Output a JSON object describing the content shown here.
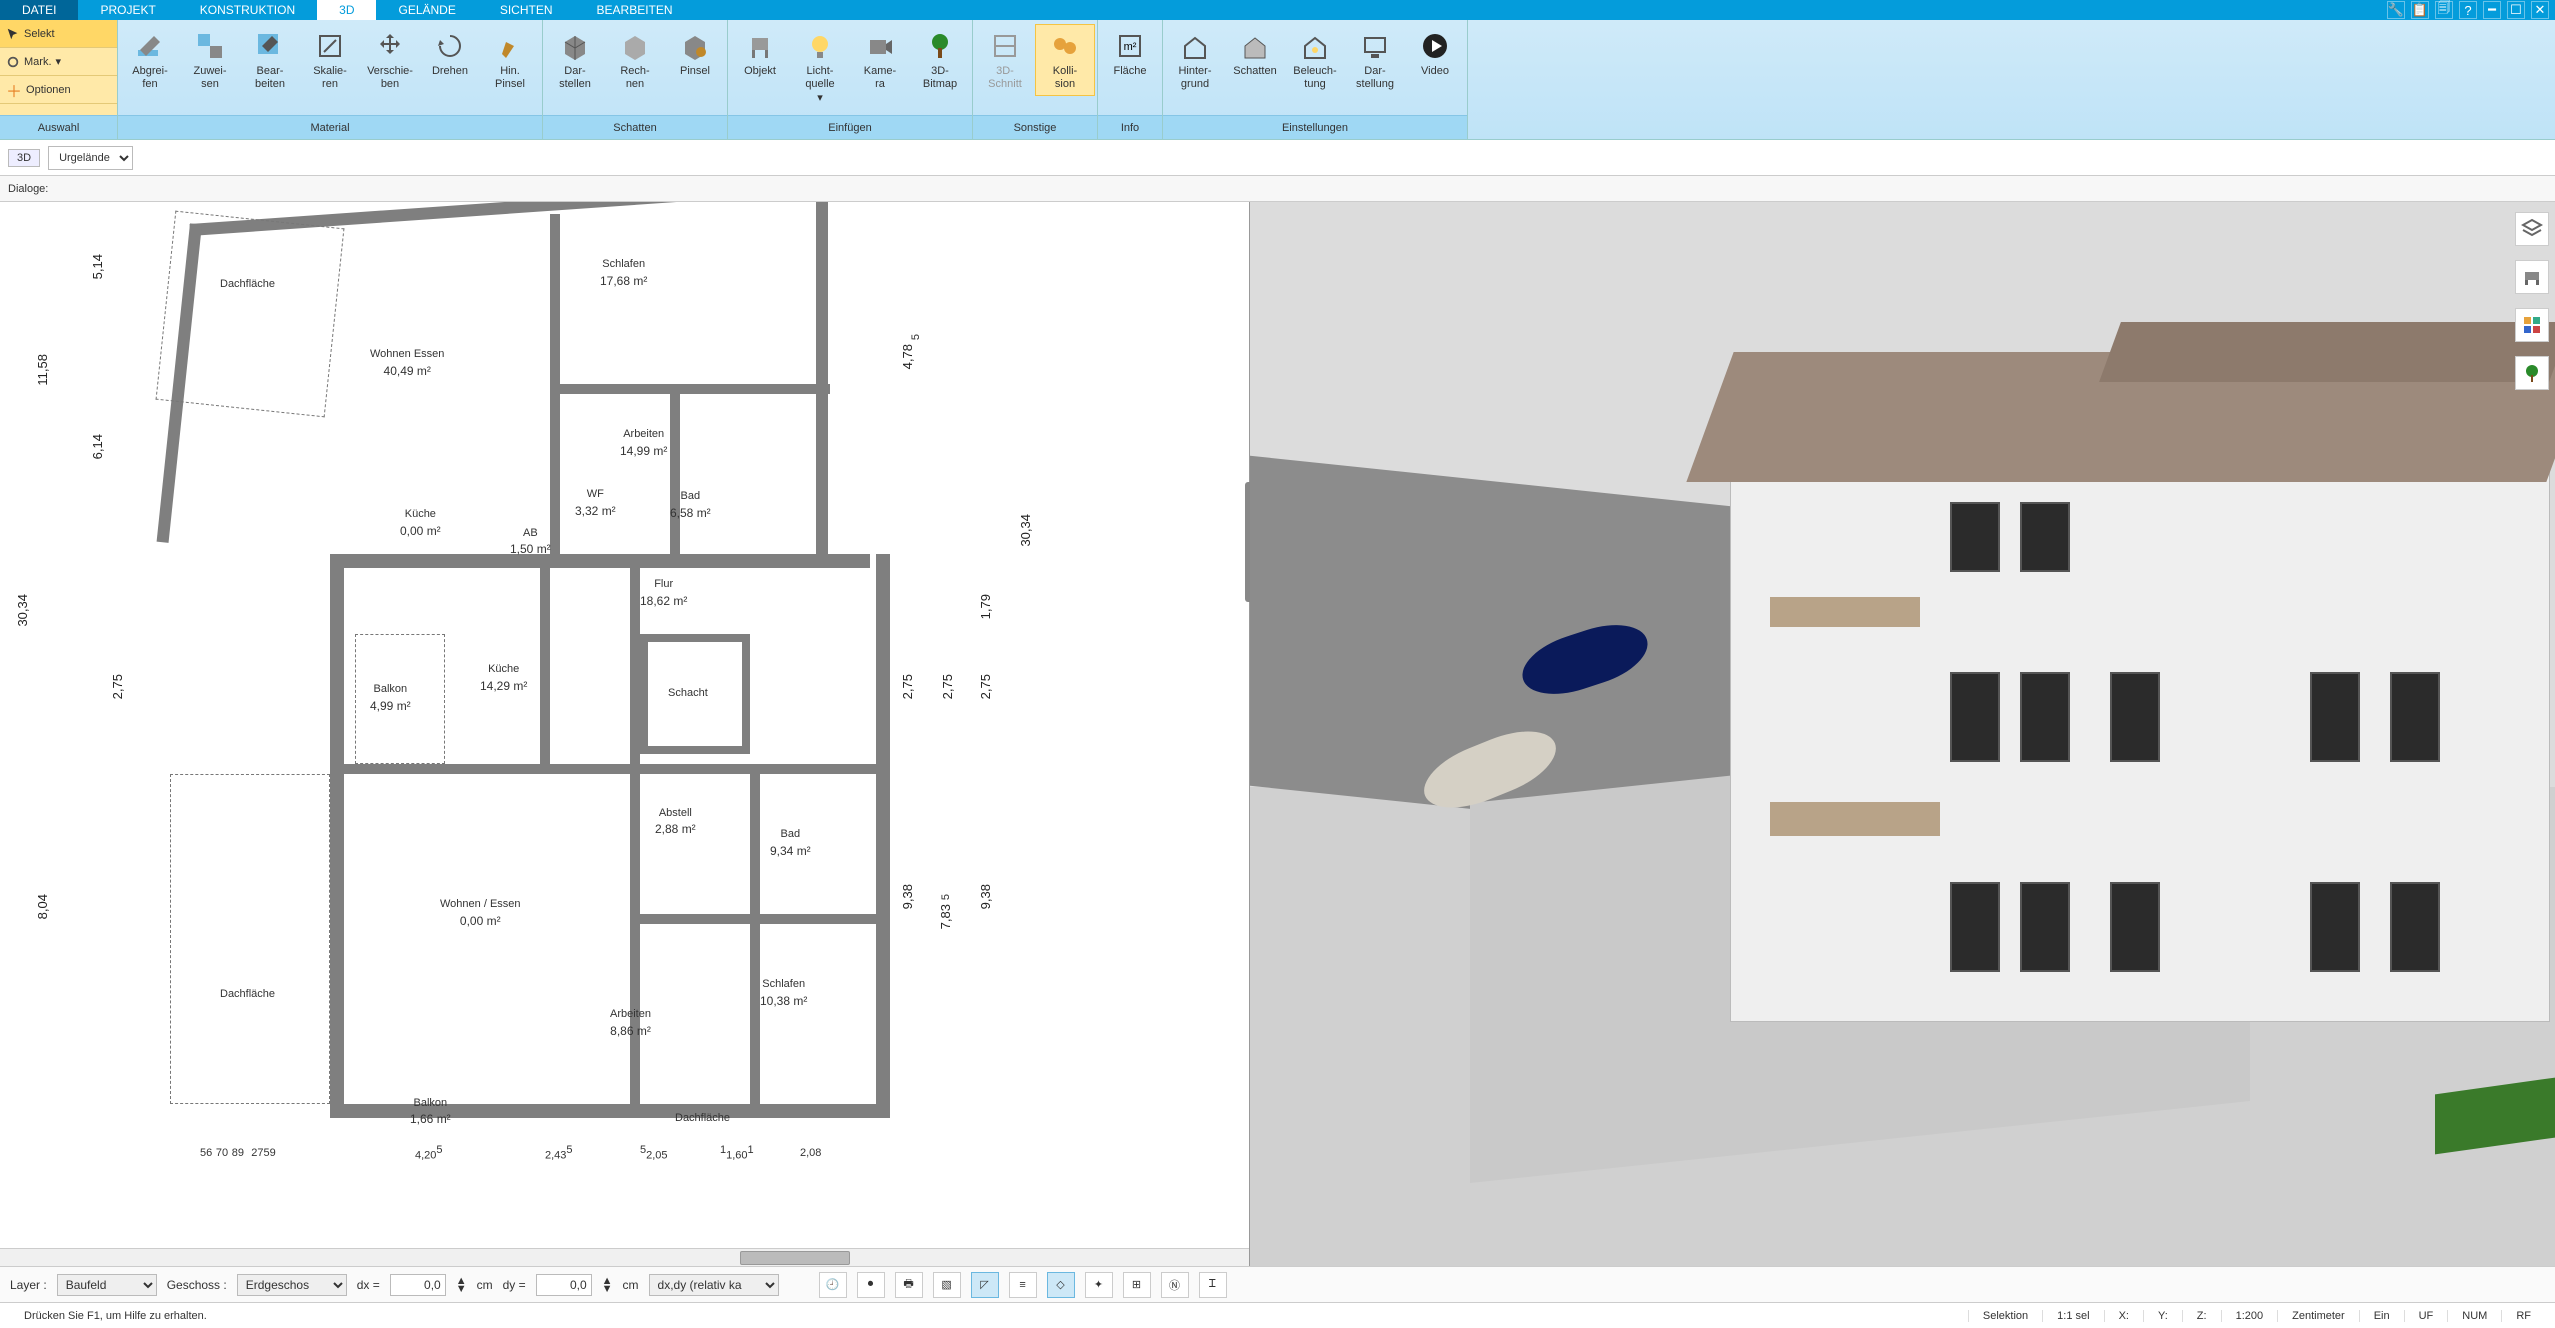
{
  "menu": {
    "datei": "DATEI",
    "projekt": "PROJEKT",
    "konstruktion": "KONSTRUKTION",
    "d3": "3D",
    "gelaende": "GELÄNDE",
    "sichten": "SICHTEN",
    "bearbeiten": "BEARBEITEN"
  },
  "sel": {
    "selekt": "Selekt",
    "mark": "Mark.",
    "optionen": "Optionen",
    "group": "Auswahl"
  },
  "ribbon": {
    "material": {
      "label": "Material",
      "abgreifen": "Abgrei-\nfen",
      "zuweisen": "Zuwei-\nsen",
      "bearbeiten": "Bear-\nbeiten",
      "skalieren": "Skalie-\nren",
      "verschieben": "Verschie-\nben",
      "drehen": "Drehen",
      "hinpinsel": "Hin.\nPinsel"
    },
    "schatten": {
      "label": "Schatten",
      "darstellen": "Dar-\nstellen",
      "rechnen": "Rech-\nnen",
      "pinsel": "Pinsel"
    },
    "einfuegen": {
      "label": "Einfügen",
      "objekt": "Objekt",
      "licht": "Licht-\nquelle",
      "kamera": "Kame-\nra",
      "bitmap": "3D-\nBitmap"
    },
    "sonstige": {
      "label": "Sonstige",
      "schnitt": "3D-\nSchnitt",
      "kollision": "Kolli-\nsion"
    },
    "info": {
      "label": "Info",
      "flaeche": "Fläche"
    },
    "einstellungen": {
      "label": "Einstellungen",
      "hintergrund": "Hinter-\ngrund",
      "schatten": "Schatten",
      "beleuchtung": "Beleuch-\ntung",
      "darstellung": "Dar-\nstellung",
      "video": "Video"
    }
  },
  "secbar": {
    "tag": "3D",
    "layer": "Urgelände"
  },
  "dlg": {
    "label": "Dialoge:"
  },
  "rooms": {
    "dach1": {
      "name": "Dachfläche"
    },
    "wohnenessen": {
      "name": "Wohnen Essen",
      "area": "40,49 m²"
    },
    "schlafen1": {
      "name": "Schlafen",
      "area": "17,68 m²"
    },
    "arbeiten1": {
      "name": "Arbeiten",
      "area": "14,99 m²"
    },
    "kueche1": {
      "name": "Küche",
      "area": "0,00 m²"
    },
    "wf": {
      "name": "WF",
      "area": "3,32 m²"
    },
    "bad1": {
      "name": "Bad",
      "area": "6,58 m²"
    },
    "ab": {
      "name": "AB",
      "area": "1,50 m²"
    },
    "flur": {
      "name": "Flur",
      "area": "18,62 m²"
    },
    "balkon1": {
      "name": "Balkon",
      "area": "4,99 m²"
    },
    "kueche2": {
      "name": "Küche",
      "area": "14,29 m²"
    },
    "schacht": {
      "name": "Schacht"
    },
    "abstell": {
      "name": "Abstell",
      "area": "2,88 m²"
    },
    "bad2": {
      "name": "Bad",
      "area": "9,34 m²"
    },
    "wohnen2": {
      "name": "Wohnen / Essen",
      "area": "0,00 m²"
    },
    "arbeiten2": {
      "name": "Arbeiten",
      "area": "8,86 m²"
    },
    "schlafen2": {
      "name": "Schlafen",
      "area": "10,38 m²"
    },
    "dach2": {
      "name": "Dachfläche"
    },
    "balkon2": {
      "name": "Balkon",
      "area": "1,66 m²"
    },
    "dach3": {
      "name": "Dachfläche"
    }
  },
  "dims": {
    "v_30_34": "30,34",
    "v_11_58": "11,58",
    "v_5_14": "5,14",
    "v_6_14": "6,14",
    "v_8_04": "8,04",
    "v_2_75": "2,75",
    "v_9_38": "9,38",
    "v_7_83": "7,83",
    "v_4_78": "4,78",
    "v_1_79": "1,79",
    "h_4_20": "4,20",
    "h_2_43": "2,43",
    "h_2_05": "2,05",
    "h_1_60": "1,60",
    "h_2_08": "2,08",
    "h_56": "56",
    "h_70": "70",
    "h_89": "89",
    "h_27": "27",
    "h_59": "59",
    "h_5l": "5",
    "h_1l": "1"
  },
  "bottom": {
    "layer_lbl": "Layer :",
    "layer_val": "Baufeld",
    "geschoss_lbl": "Geschoss :",
    "geschoss_val": "Erdgeschos",
    "dx_lbl": "dx =",
    "dx_val": "0,0",
    "dy_lbl": "dy =",
    "dy_val": "0,0",
    "cm": "cm",
    "mode": "dx,dy (relativ ka"
  },
  "status": {
    "help": "Drücken Sie F1, um Hilfe zu erhalten.",
    "sel": "Selektion",
    "ratio": "1:1 sel",
    "x": "X:",
    "y": "Y:",
    "z": "Z:",
    "scale": "1:200",
    "unit": "Zentimeter",
    "ein": "Ein",
    "uf": "UF",
    "num": "NUM",
    "rf": "RF"
  }
}
